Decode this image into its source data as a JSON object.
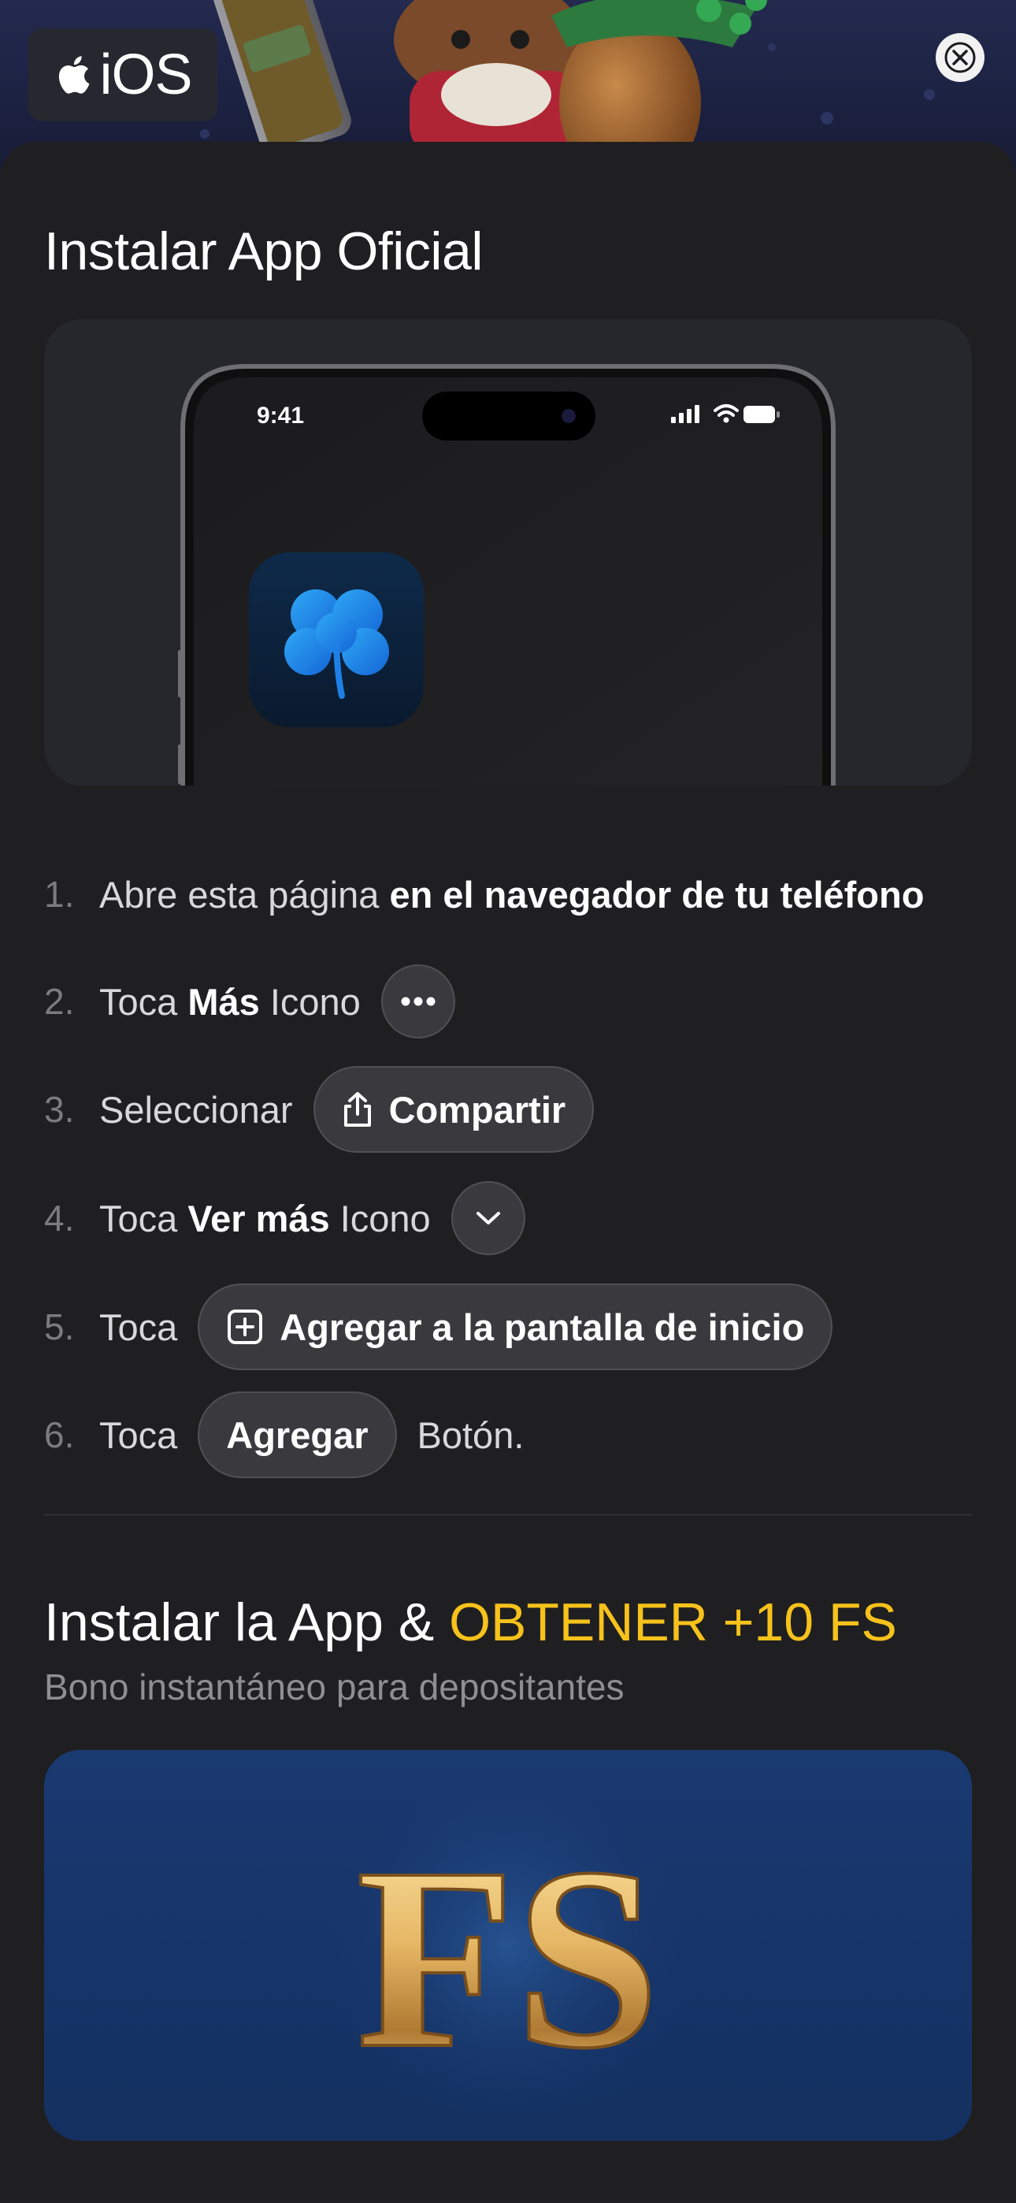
{
  "header": {
    "os_label": "iOS",
    "close_icon": "close-icon"
  },
  "install": {
    "title": "Instalar App Oficial",
    "phone_time": "9:41",
    "steps": [
      {
        "num": "1.",
        "text_pre": "Abre esta página ",
        "text_bold": "en el navegador de tu teléfono"
      },
      {
        "num": "2.",
        "text_pre": "Toca ",
        "text_bold": "Más",
        "text_post": " Icono"
      },
      {
        "num": "3.",
        "text_pre": "Seleccionar",
        "button": "Compartir"
      },
      {
        "num": "4.",
        "text_pre": "Toca ",
        "text_bold": "Ver más",
        "text_post": " Icono"
      },
      {
        "num": "5.",
        "text_pre": "Toca",
        "button": "Agregar a la pantalla de inicio"
      },
      {
        "num": "6.",
        "text_pre": "Toca",
        "button": "Agregar",
        "text_after": "Botón."
      }
    ]
  },
  "promo": {
    "title_pre": "Instalar la App & ",
    "title_highlight": "OBTENER +10 FS",
    "subtitle": "Bono instantáneo para depositantes",
    "badge_text": "FS"
  },
  "colors": {
    "accent_yellow": "#f6c21b",
    "sheet_bg": "#1f1f21",
    "pill_bg": "#3a3a3e"
  }
}
